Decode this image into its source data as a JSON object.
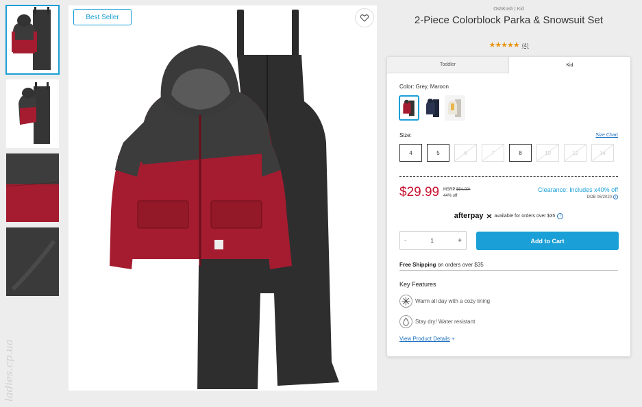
{
  "badge": "Best Seller",
  "brand": "OshKosh | Kid",
  "title": "2-Piece Colorblock Parka & Snowsuit Set",
  "rating": {
    "stars": "★★★★★",
    "count": "(4)"
  },
  "tabs": [
    "Toddler",
    "Kid"
  ],
  "color": {
    "label": "Color:",
    "value": "Grey, Maroon"
  },
  "size": {
    "label": "Size:",
    "chart_link": "Size Chart",
    "options": [
      "4",
      "5",
      "6",
      "7",
      "8",
      "10",
      "12",
      "14"
    ]
  },
  "price": {
    "sale": "$29.99",
    "msrp_label": "MSRP",
    "msrp_value": "$54.00*",
    "discount": "44% off",
    "clearance": "Clearance: Includes x40% off",
    "dob": "DOB 06/2020"
  },
  "afterpay": {
    "logo": "afterpay",
    "text": "available for orders over $35"
  },
  "quantity": {
    "minus": "-",
    "value": "1",
    "plus": "+"
  },
  "add_to_cart": "Add to Cart",
  "shipping": {
    "bold": "Free Shipping",
    "text": "on orders over $35"
  },
  "key_features": {
    "title": "Key Features",
    "items": [
      "Warm all day with a cozy lining",
      "Stay dry! Water resistant"
    ]
  },
  "view_details": "View Product Details",
  "view_details_plus": "+",
  "watermark": "ladies.cp.ua",
  "colors": {
    "accent": "#1a9fd6",
    "price": "#c8102e",
    "maroon": "#a51c30",
    "charcoal": "#3a3a3a"
  }
}
